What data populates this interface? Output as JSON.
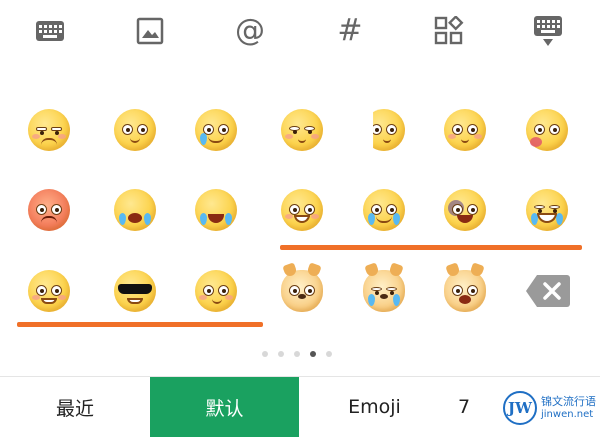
{
  "toolbar": {
    "icons": [
      "keyboard-icon",
      "image-icon",
      "at-sign-icon",
      "hashtag-icon",
      "apps-icon",
      "hide-keyboard-icon"
    ],
    "at_symbol": "@",
    "hash_symbol": "#"
  },
  "emoji_grid": {
    "rows": [
      [
        "embarrassed-emoji",
        "dizzy-emoji",
        "waving-tears-emoji",
        "smug-emoji",
        "peeking-emoji",
        "shush-emoji",
        "vomit-emoji"
      ],
      [
        "angry-emoji",
        "crying-emoji",
        "laugh-cry-hands-emoji",
        "grin-squint-emoji",
        "laugh-tears-emoji",
        "bruised-emoji",
        "big-laugh-emoji"
      ],
      [
        "shy-smile-emoji",
        "sunglasses-emoji",
        "smirk-emoji",
        "doge-emoji",
        "doge-tears-emoji",
        "doge-shocked-emoji"
      ]
    ],
    "accent_color": "#f07028"
  },
  "delete_key": {
    "icon": "backspace-icon"
  },
  "pager": {
    "total": 5,
    "current": 4
  },
  "tabs": [
    {
      "label": "最近",
      "selected": false
    },
    {
      "label": "默认",
      "selected": true
    },
    {
      "label": "Emoji",
      "selected": false
    },
    {
      "label": "7",
      "selected": false
    }
  ],
  "selected_tab_color": "#1aa160",
  "watermark": {
    "logo_text": "JW",
    "name": "锦文流行语",
    "url": "jinwen.net"
  }
}
